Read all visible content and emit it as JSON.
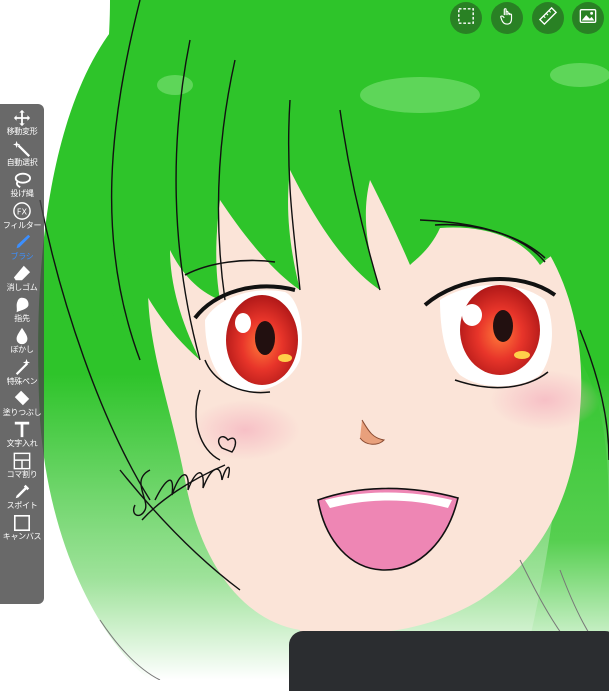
{
  "canvas": {
    "hair_color": "#2ec42a",
    "skin_color": "#fbe4d8",
    "eye_color": "#e8352a",
    "mouth_color": "#ee86b4",
    "line_color": "#111111",
    "signature_text": "Sakura"
  },
  "toolbar": {
    "active_color": "#3b8fff",
    "items": [
      {
        "label": "移動変形",
        "icon": "move-arrows-icon"
      },
      {
        "label": "自動選択",
        "icon": "magic-wand-icon"
      },
      {
        "label": "投げ縄",
        "icon": "lasso-icon"
      },
      {
        "label": "フィルター",
        "icon": "fx-icon"
      },
      {
        "label": "ブラシ",
        "icon": "brush-icon"
      },
      {
        "label": "消しゴム",
        "icon": "eraser-icon"
      },
      {
        "label": "指先",
        "icon": "finger-smudge-icon"
      },
      {
        "label": "ぼかし",
        "icon": "drop-blur-icon"
      },
      {
        "label": "特殊ペン",
        "icon": "special-pen-icon"
      },
      {
        "label": "塗りつぶし",
        "icon": "bucket-fill-icon"
      },
      {
        "label": "文字入れ",
        "icon": "text-icon"
      },
      {
        "label": "コマ割り",
        "icon": "panel-split-icon"
      },
      {
        "label": "スポイト",
        "icon": "eyedropper-icon"
      },
      {
        "label": "キャンバス",
        "icon": "canvas-icon"
      }
    ]
  },
  "top_buttons": [
    {
      "icon": "selection-icon"
    },
    {
      "icon": "hand-gesture-icon"
    },
    {
      "icon": "ruler-icon"
    },
    {
      "icon": "gallery-icon"
    }
  ]
}
